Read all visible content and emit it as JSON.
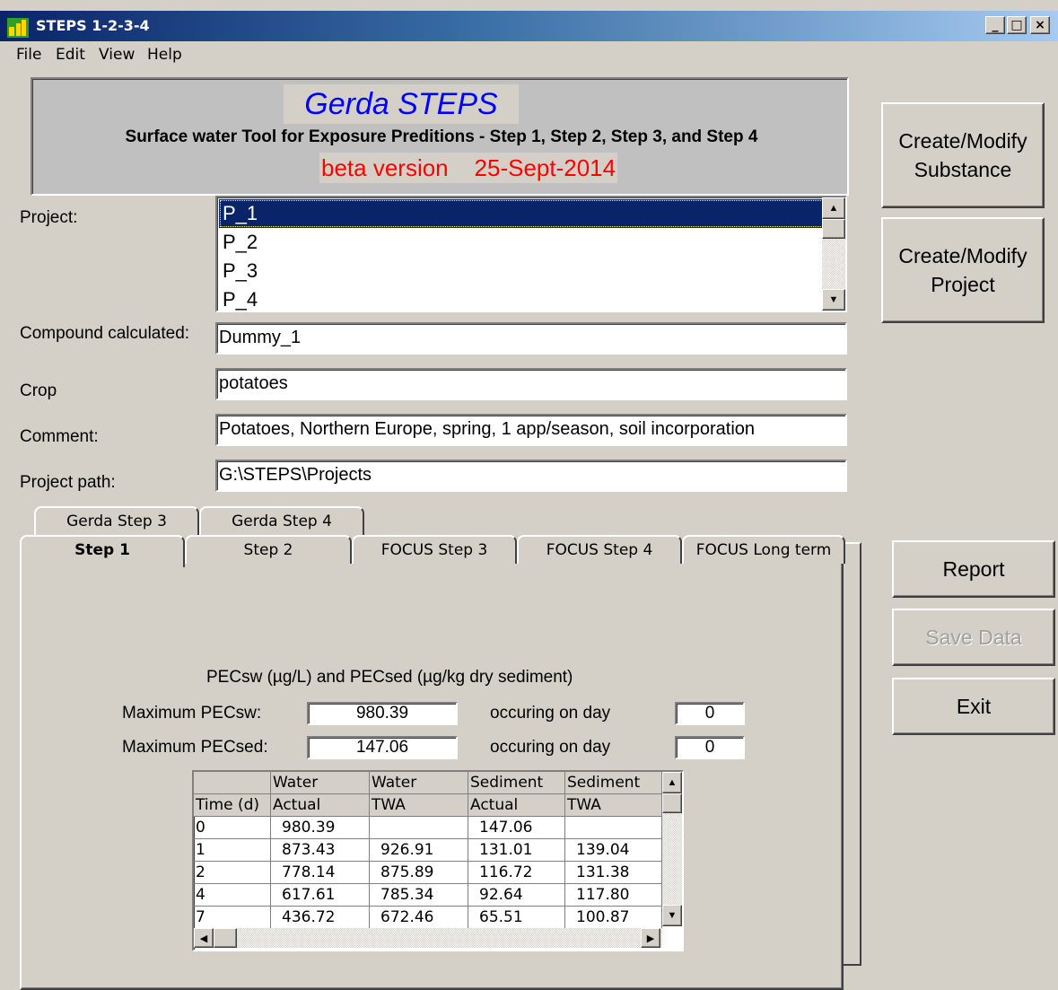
{
  "window": {
    "title": "STEPS 1-2-3-4",
    "min": "_",
    "max": "□",
    "close": "×"
  },
  "menu": [
    "File",
    "Edit",
    "View",
    "Help"
  ],
  "banner": {
    "brand": "Gerda STEPS",
    "subtitle": "Surface water Tool for Exposure Preditions - Step 1, Step 2, Step 3, and Step 4",
    "version": "beta version    25-Sept-2014"
  },
  "project": {
    "label": "Project:",
    "items": [
      "P_1",
      "P_2",
      "P_3",
      "P_4"
    ],
    "selected": "P_1"
  },
  "fields": {
    "compound_label": "Compound calculated:",
    "compound_value": "Dummy_1",
    "crop_label": "Crop",
    "crop_value": "potatoes",
    "comment_label": "Comment:",
    "comment_value": "Potatoes, Northern Europe, spring, 1 app/season, soil incorporation",
    "path_label": "Project path:",
    "path_value": "G:\\STEPS\\Projects"
  },
  "buttons": {
    "substance": "Create/Modify Substance",
    "project": "Create/Modify Project",
    "report": "Report",
    "save": "Save Data",
    "exit": "Exit"
  },
  "tabs_back": [
    "Gerda Step 3",
    "Gerda Step 4"
  ],
  "tabs_front": [
    "Step 1",
    "Step 2",
    "FOCUS Step 3",
    "FOCUS Step 4",
    "FOCUS Long term"
  ],
  "pec": {
    "heading": "PECsw (µg/L) and PECsed (µg/kg dry sediment)",
    "max_sw_label": "Maximum PECsw:",
    "max_sw_value": "980.39",
    "max_sed_label": "Maximum PECsed:",
    "max_sed_value": "147.06",
    "occ_label": "occuring on day",
    "sw_day": "0",
    "sed_day": "0"
  },
  "table": {
    "header1": [
      "",
      "Water",
      "Water",
      "Sediment",
      "Sediment"
    ],
    "header2": [
      "Time (d)",
      "Actual",
      "TWA",
      "Actual",
      "TWA"
    ],
    "rows": [
      [
        "0",
        "980.39",
        "",
        "147.06",
        ""
      ],
      [
        "1",
        "873.43",
        "926.91",
        "131.01",
        "139.04"
      ],
      [
        "2",
        "778.14",
        "875.89",
        "116.72",
        "131.38"
      ],
      [
        "4",
        "617.61",
        "785.34",
        "92.64",
        "117.80"
      ],
      [
        "7",
        "436.72",
        "672.46",
        "65.51",
        "100.87"
      ]
    ]
  }
}
